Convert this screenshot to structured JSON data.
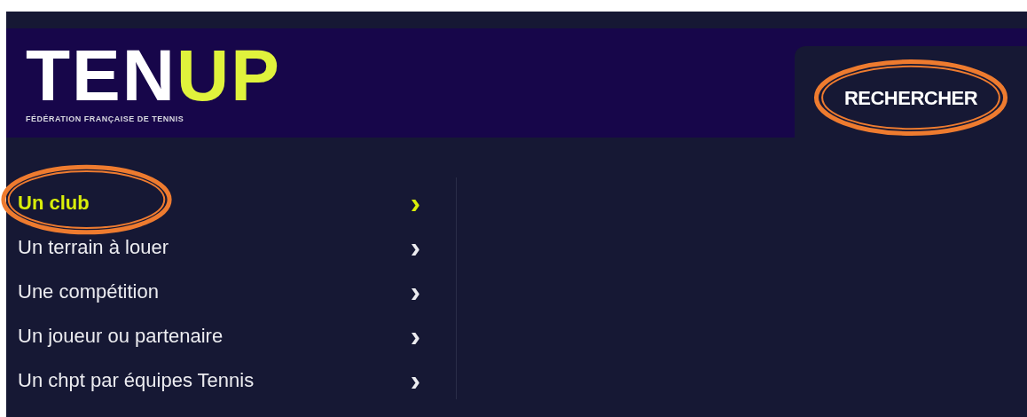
{
  "logo": {
    "white_part": "TEN",
    "accent_part": "UP",
    "tagline": "FÉDÉRATION FRANÇAISE DE TENNIS"
  },
  "search_button": {
    "label": "RECHERCHER",
    "highlighted": true
  },
  "menu": [
    {
      "label": "Un club",
      "selected": true,
      "highlighted": true,
      "chevron": "›"
    },
    {
      "label": "Un terrain à louer",
      "selected": false,
      "highlighted": false,
      "chevron": "›"
    },
    {
      "label": "Une compétition",
      "selected": false,
      "highlighted": false,
      "chevron": "›"
    },
    {
      "label": "Un joueur ou partenaire",
      "selected": false,
      "highlighted": false,
      "chevron": "›"
    },
    {
      "label": "Un chpt par équipes Tennis",
      "selected": false,
      "highlighted": false,
      "chevron": "›"
    }
  ]
}
